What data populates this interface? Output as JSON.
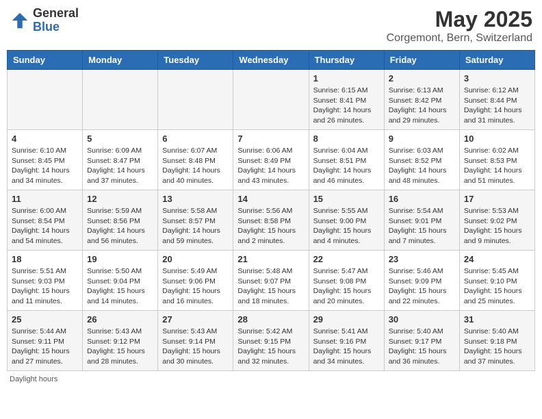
{
  "header": {
    "logo_general": "General",
    "logo_blue": "Blue",
    "month_title": "May 2025",
    "location": "Corgemont, Bern, Switzerland"
  },
  "days_of_week": [
    "Sunday",
    "Monday",
    "Tuesday",
    "Wednesday",
    "Thursday",
    "Friday",
    "Saturday"
  ],
  "weeks": [
    [
      {
        "day": "",
        "empty": true
      },
      {
        "day": "",
        "empty": true
      },
      {
        "day": "",
        "empty": true
      },
      {
        "day": "",
        "empty": true
      },
      {
        "day": "1",
        "sunrise": "6:15 AM",
        "sunset": "8:41 PM",
        "daylight": "14 hours and 26 minutes."
      },
      {
        "day": "2",
        "sunrise": "6:13 AM",
        "sunset": "8:42 PM",
        "daylight": "14 hours and 29 minutes."
      },
      {
        "day": "3",
        "sunrise": "6:12 AM",
        "sunset": "8:44 PM",
        "daylight": "14 hours and 31 minutes."
      }
    ],
    [
      {
        "day": "4",
        "sunrise": "6:10 AM",
        "sunset": "8:45 PM",
        "daylight": "14 hours and 34 minutes."
      },
      {
        "day": "5",
        "sunrise": "6:09 AM",
        "sunset": "8:47 PM",
        "daylight": "14 hours and 37 minutes."
      },
      {
        "day": "6",
        "sunrise": "6:07 AM",
        "sunset": "8:48 PM",
        "daylight": "14 hours and 40 minutes."
      },
      {
        "day": "7",
        "sunrise": "6:06 AM",
        "sunset": "8:49 PM",
        "daylight": "14 hours and 43 minutes."
      },
      {
        "day": "8",
        "sunrise": "6:04 AM",
        "sunset": "8:51 PM",
        "daylight": "14 hours and 46 minutes."
      },
      {
        "day": "9",
        "sunrise": "6:03 AM",
        "sunset": "8:52 PM",
        "daylight": "14 hours and 48 minutes."
      },
      {
        "day": "10",
        "sunrise": "6:02 AM",
        "sunset": "8:53 PM",
        "daylight": "14 hours and 51 minutes."
      }
    ],
    [
      {
        "day": "11",
        "sunrise": "6:00 AM",
        "sunset": "8:54 PM",
        "daylight": "14 hours and 54 minutes."
      },
      {
        "day": "12",
        "sunrise": "5:59 AM",
        "sunset": "8:56 PM",
        "daylight": "14 hours and 56 minutes."
      },
      {
        "day": "13",
        "sunrise": "5:58 AM",
        "sunset": "8:57 PM",
        "daylight": "14 hours and 59 minutes."
      },
      {
        "day": "14",
        "sunrise": "5:56 AM",
        "sunset": "8:58 PM",
        "daylight": "15 hours and 2 minutes."
      },
      {
        "day": "15",
        "sunrise": "5:55 AM",
        "sunset": "9:00 PM",
        "daylight": "15 hours and 4 minutes."
      },
      {
        "day": "16",
        "sunrise": "5:54 AM",
        "sunset": "9:01 PM",
        "daylight": "15 hours and 7 minutes."
      },
      {
        "day": "17",
        "sunrise": "5:53 AM",
        "sunset": "9:02 PM",
        "daylight": "15 hours and 9 minutes."
      }
    ],
    [
      {
        "day": "18",
        "sunrise": "5:51 AM",
        "sunset": "9:03 PM",
        "daylight": "15 hours and 11 minutes."
      },
      {
        "day": "19",
        "sunrise": "5:50 AM",
        "sunset": "9:04 PM",
        "daylight": "15 hours and 14 minutes."
      },
      {
        "day": "20",
        "sunrise": "5:49 AM",
        "sunset": "9:06 PM",
        "daylight": "15 hours and 16 minutes."
      },
      {
        "day": "21",
        "sunrise": "5:48 AM",
        "sunset": "9:07 PM",
        "daylight": "15 hours and 18 minutes."
      },
      {
        "day": "22",
        "sunrise": "5:47 AM",
        "sunset": "9:08 PM",
        "daylight": "15 hours and 20 minutes."
      },
      {
        "day": "23",
        "sunrise": "5:46 AM",
        "sunset": "9:09 PM",
        "daylight": "15 hours and 22 minutes."
      },
      {
        "day": "24",
        "sunrise": "5:45 AM",
        "sunset": "9:10 PM",
        "daylight": "15 hours and 25 minutes."
      }
    ],
    [
      {
        "day": "25",
        "sunrise": "5:44 AM",
        "sunset": "9:11 PM",
        "daylight": "15 hours and 27 minutes."
      },
      {
        "day": "26",
        "sunrise": "5:43 AM",
        "sunset": "9:12 PM",
        "daylight": "15 hours and 28 minutes."
      },
      {
        "day": "27",
        "sunrise": "5:43 AM",
        "sunset": "9:14 PM",
        "daylight": "15 hours and 30 minutes."
      },
      {
        "day": "28",
        "sunrise": "5:42 AM",
        "sunset": "9:15 PM",
        "daylight": "15 hours and 32 minutes."
      },
      {
        "day": "29",
        "sunrise": "5:41 AM",
        "sunset": "9:16 PM",
        "daylight": "15 hours and 34 minutes."
      },
      {
        "day": "30",
        "sunrise": "5:40 AM",
        "sunset": "9:17 PM",
        "daylight": "15 hours and 36 minutes."
      },
      {
        "day": "31",
        "sunrise": "5:40 AM",
        "sunset": "9:18 PM",
        "daylight": "15 hours and 37 minutes."
      }
    ]
  ],
  "footer": {
    "daylight_label": "Daylight hours"
  },
  "labels": {
    "sunrise": "Sunrise: ",
    "sunset": "Sunset: ",
    "daylight": "Daylight: "
  }
}
